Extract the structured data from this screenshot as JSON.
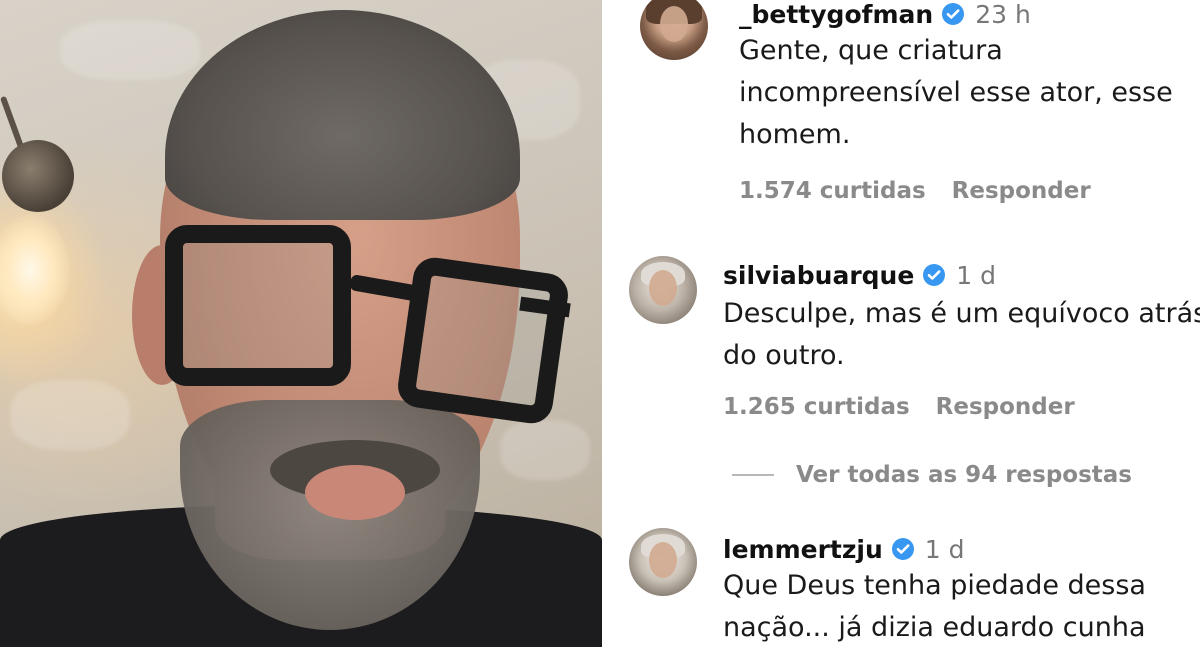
{
  "video": {
    "description_icon": "video-frame"
  },
  "comments": [
    {
      "username": "_bettygofman",
      "verified": true,
      "time": "23 h",
      "text_lines": [
        "Gente, que criatura",
        "incompreensível esse ator, esse",
        "homem."
      ],
      "likes": "1.574 curtidas",
      "reply_label": "Responder"
    },
    {
      "username": "silviabuarque",
      "verified": true,
      "time": "1 d",
      "text_lines": [
        "Desculpe, mas é um equívoco atrás",
        "do outro."
      ],
      "likes": "1.265 curtidas",
      "reply_label": "Responder"
    },
    {
      "username": "lemmertzju",
      "verified": true,
      "time": "1 d",
      "text_lines": [
        "Que Deus tenha piedade dessa",
        "nação... já dizia eduardo cunha"
      ]
    }
  ],
  "view_replies": {
    "label": "Ver todas as 94 respostas"
  },
  "colors": {
    "verified_badge": "#3897f0",
    "secondary_text": "#8a8a8a"
  }
}
